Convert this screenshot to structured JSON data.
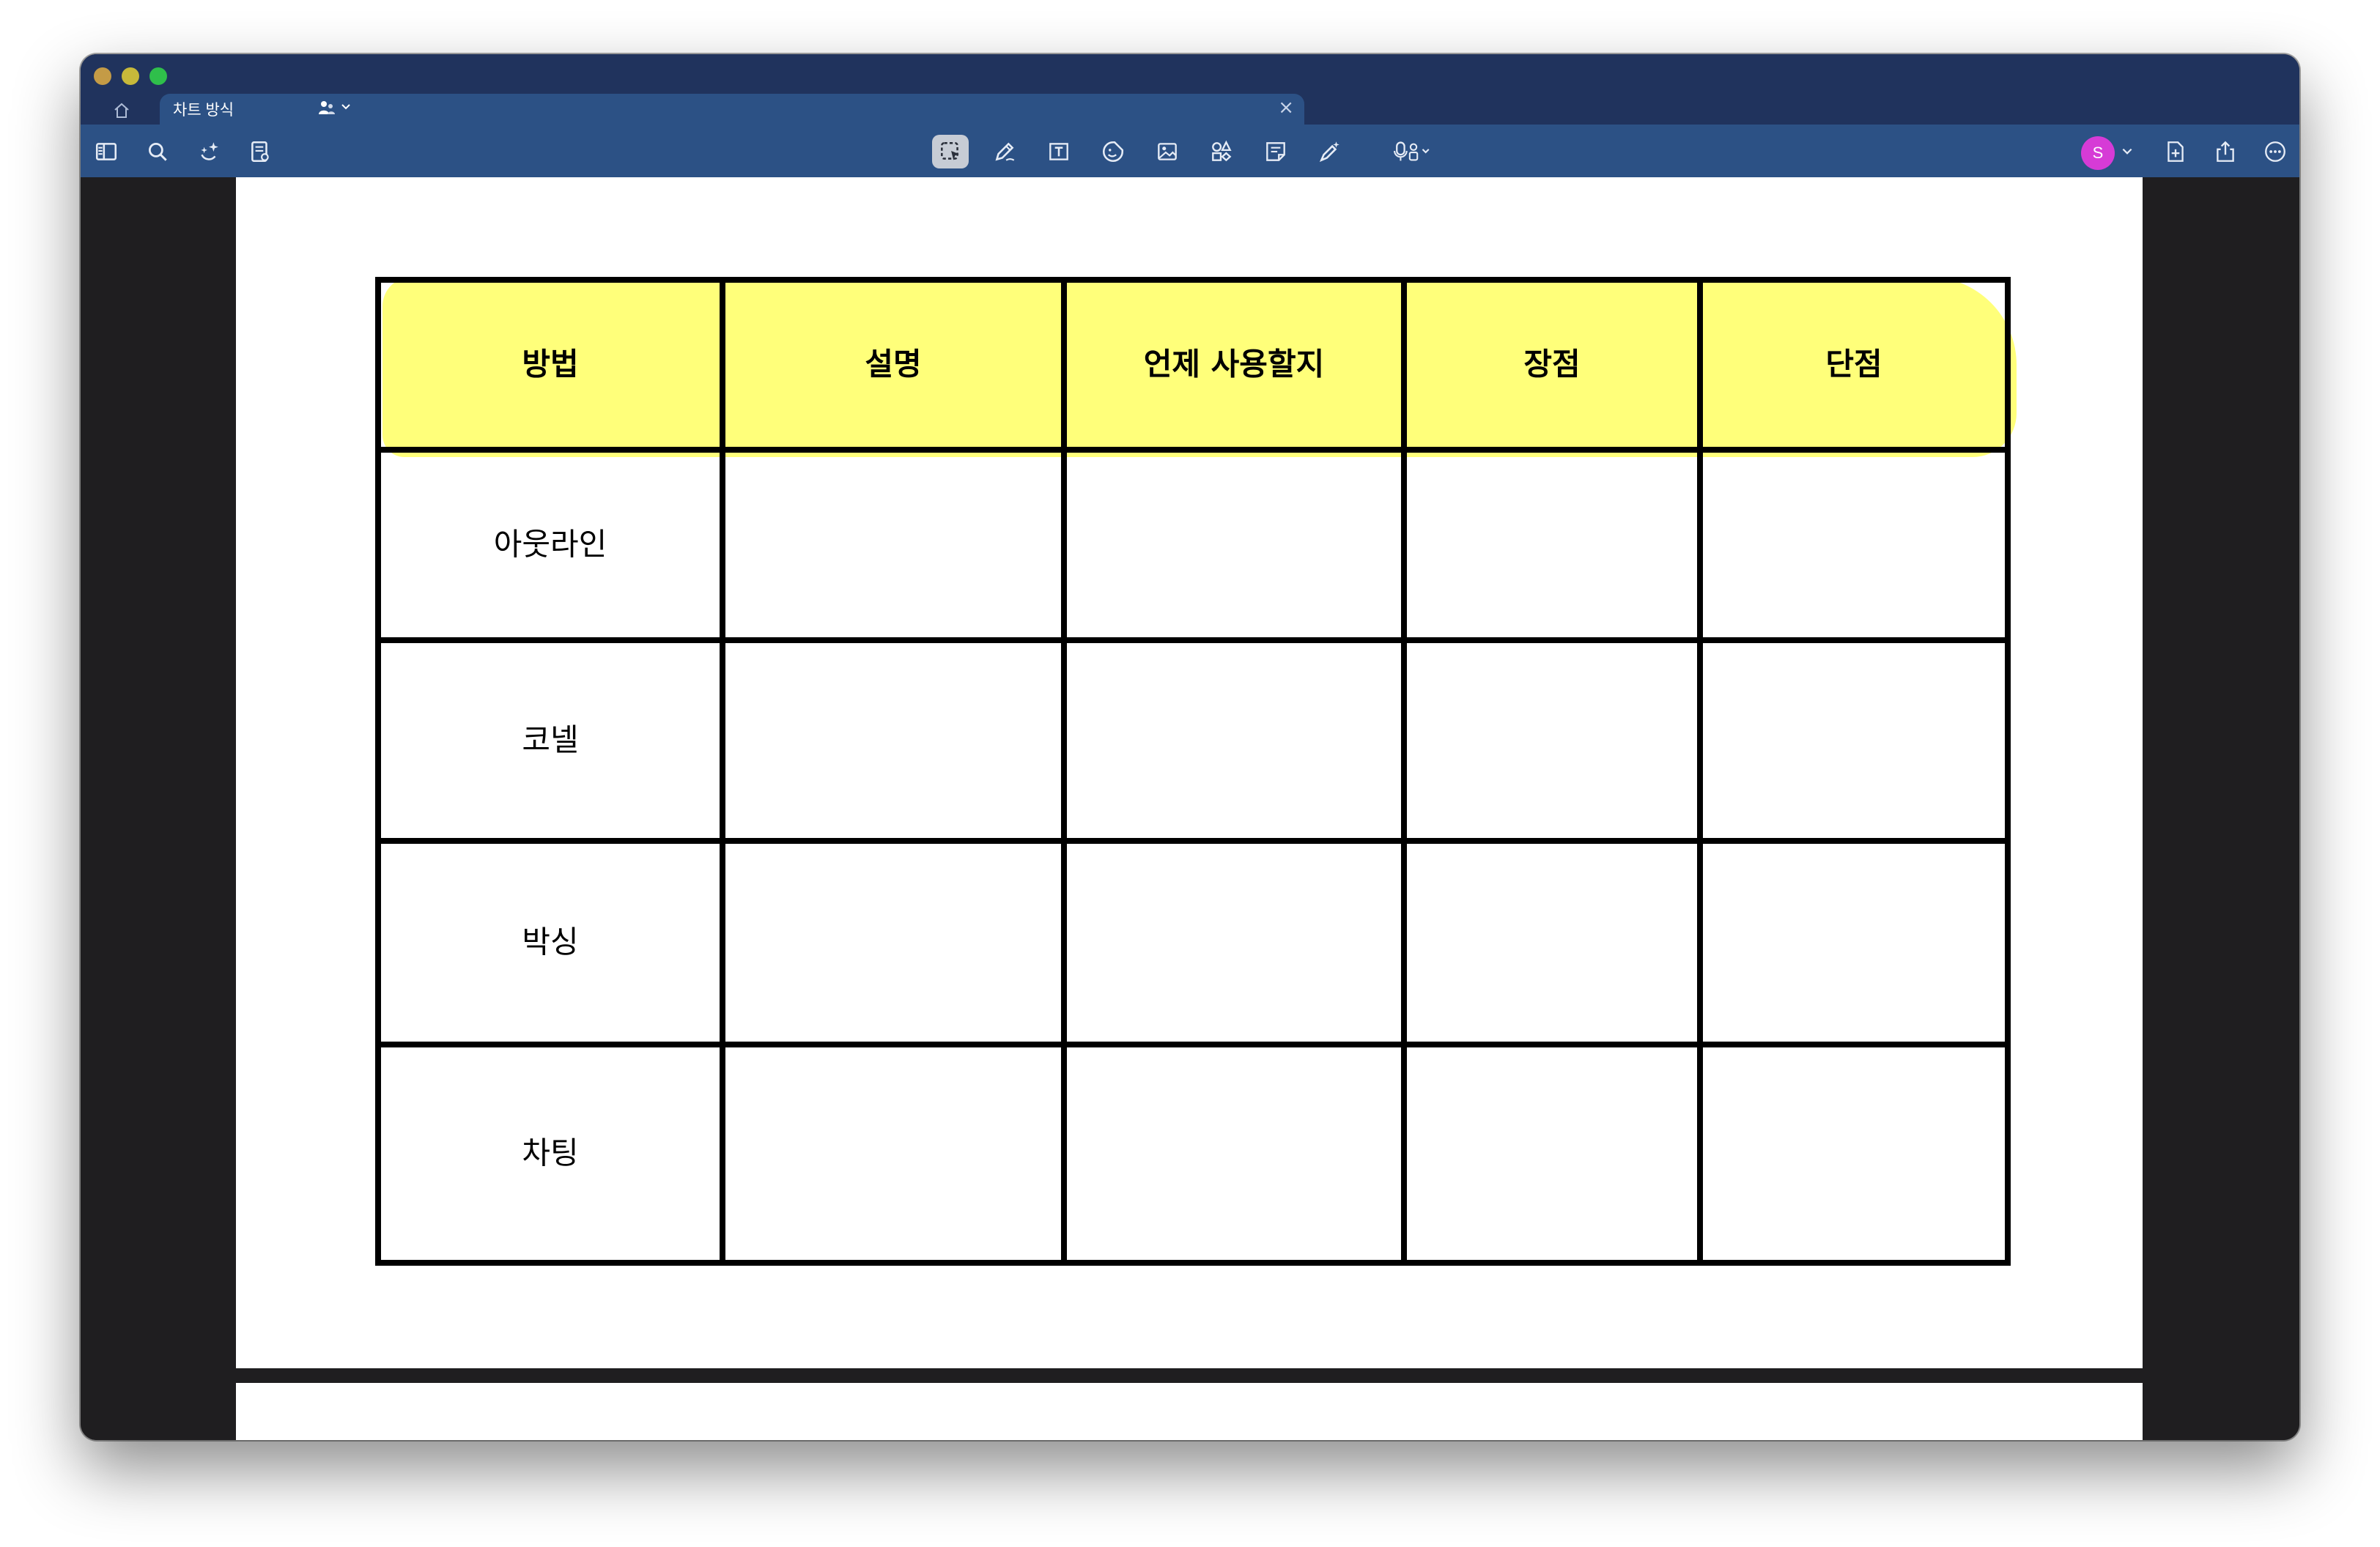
{
  "window": {
    "tab_title": "차트 방식",
    "tab_close": "×"
  },
  "toolbar": {
    "left_icons": [
      "sidebar-icon",
      "search-icon",
      "ai-sparkle-icon",
      "notes-icon"
    ],
    "center_icons": [
      "lasso-select-icon",
      "pen-icon",
      "text-box-icon",
      "sticker-icon",
      "image-icon",
      "shapes-icon",
      "sticky-note-icon",
      "magic-pen-icon",
      "microphone-icon"
    ],
    "right_icons": [
      "new-page-icon",
      "share-icon",
      "more-icon"
    ],
    "avatar_initial": "S",
    "avatar_color": "#d63bd6"
  },
  "colors": {
    "titlebar": "#20335d",
    "toolbar": "#2c5185",
    "highlight": "#ffff7a",
    "canvas_bg": "#1f1e20"
  },
  "table": {
    "headers": [
      "방법",
      "설명",
      "언제 사용할지",
      "장점",
      "단점"
    ],
    "rows": [
      [
        "아웃라인",
        "",
        "",
        "",
        ""
      ],
      [
        "코넬",
        "",
        "",
        "",
        ""
      ],
      [
        "박싱",
        "",
        "",
        "",
        ""
      ],
      [
        "차팅",
        "",
        "",
        "",
        ""
      ]
    ]
  }
}
